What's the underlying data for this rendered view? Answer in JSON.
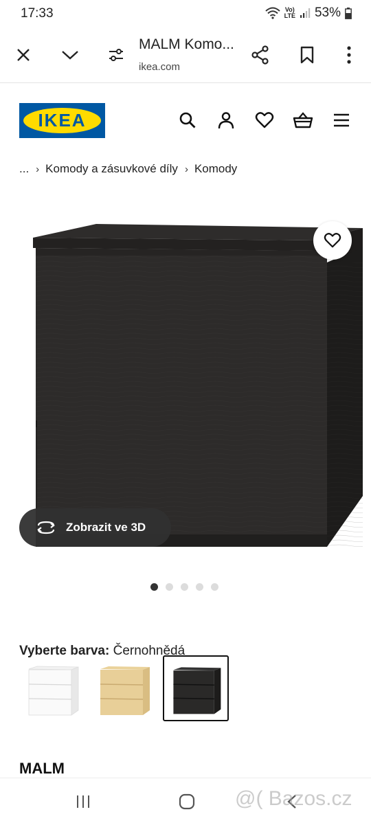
{
  "status_bar": {
    "time": "17:33",
    "network_top": "Vo)",
    "network_bottom": "LTE",
    "battery_percent": "53%"
  },
  "browser": {
    "page_title": "MALM Komo...",
    "url": "ikea.com"
  },
  "site": {
    "logo_text": "IKEA",
    "brand_blue": "#0058a3",
    "brand_yellow": "#ffdb00"
  },
  "breadcrumb": {
    "ellipsis": "...",
    "items": [
      "Komody a zásuvkové díly",
      "Komody"
    ]
  },
  "gallery": {
    "view_3d_label": "Zobrazit ve 3D",
    "image_count": 5,
    "active_image": 1
  },
  "color_selector": {
    "label": "Vyberte barva:",
    "selected_value": "Černohnědá",
    "options": [
      {
        "name": "white-variant",
        "selected": false
      },
      {
        "name": "oak-variant",
        "selected": false
      },
      {
        "name": "black-brown-variant",
        "selected": true
      }
    ]
  },
  "product": {
    "name": "MALM"
  },
  "watermark": "@( Bazos.cz"
}
